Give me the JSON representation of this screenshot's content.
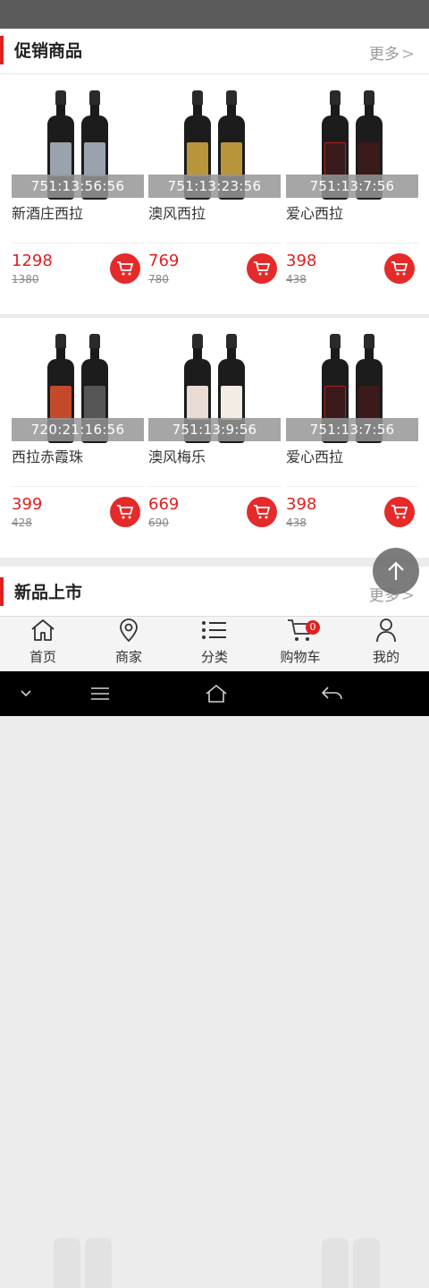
{
  "promo": {
    "title": "促销商品",
    "more": "更多",
    "products": [
      {
        "name": "新酒庄西拉",
        "timer": "751:13:56:56",
        "price": "1298",
        "old_price": "1380",
        "label_color": "#9aa3ad"
      },
      {
        "name": "澳风西拉",
        "timer": "751:13:23:56",
        "price": "769",
        "old_price": "780",
        "label_color": "#b8953a"
      },
      {
        "name": "爱心西拉",
        "timer": "751:13:7:56",
        "price": "398",
        "old_price": "438",
        "label_color": "#3a1a1a"
      },
      {
        "name": "西拉赤霞珠",
        "timer": "720:21:16:56",
        "price": "399",
        "old_price": "428",
        "label_color": "#c24a2a"
      },
      {
        "name": "澳风梅乐",
        "timer": "751:13:9:56",
        "price": "669",
        "old_price": "690",
        "label_color": "#e9dcd4"
      },
      {
        "name": "爱心西拉",
        "timer": "751:13:7:56",
        "price": "398",
        "old_price": "438",
        "label_color": "#3a1a1a"
      }
    ]
  },
  "new_arrivals": {
    "title": "新品上市",
    "more": "更多"
  },
  "tabbar": {
    "items": [
      {
        "label": "首页",
        "icon": "home-icon"
      },
      {
        "label": "商家",
        "icon": "location-pin-icon"
      },
      {
        "label": "分类",
        "icon": "list-icon"
      },
      {
        "label": "购物车",
        "icon": "shopping-cart-icon",
        "badge": "0"
      },
      {
        "label": "我的",
        "icon": "person-icon"
      }
    ]
  },
  "colors": {
    "accent": "#e02020",
    "timer_bg": "#969696"
  }
}
